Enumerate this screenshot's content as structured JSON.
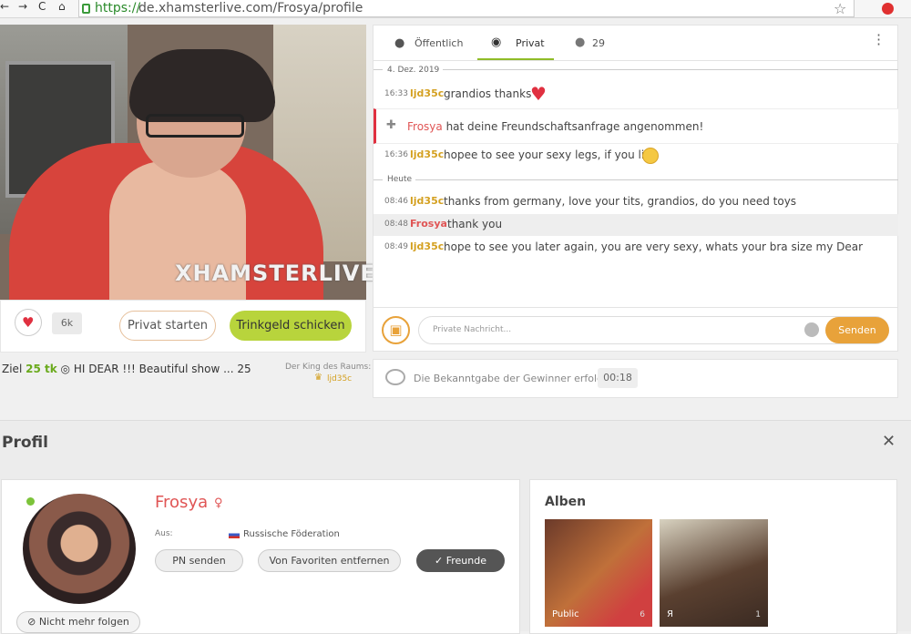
{
  "browser": {
    "back": "←",
    "forward": "→",
    "reload": "C",
    "home": "⌂",
    "url_scheme": "https://",
    "url_rest": "de.xhamsterlive.com/Frosya/profile",
    "star": "☆"
  },
  "video": {
    "watermark": "XHAMSTERLIVE"
  },
  "actions": {
    "likes": "6k",
    "private_label": "Privat starten",
    "tip_label": "Trinkgeld schicken"
  },
  "goal": {
    "prefix": "Ziel",
    "amount": "25 tk",
    "text": "HI DEAR !!! Beautiful show ... 25",
    "king_label": "Der King des Raums:",
    "king_name": "ljd35c"
  },
  "chat": {
    "tabs": [
      {
        "label": "Öffentlich",
        "icon": "speech-bubble-icon"
      },
      {
        "label": "Privat",
        "icon": "chat-bubbles-icon"
      },
      {
        "label": "29",
        "icon": "user-icon"
      }
    ],
    "date1": "4. Dez. 2019",
    "date2": "Heute",
    "messages": [
      {
        "time": "16:33",
        "user": "ljd35c",
        "text": "grandios thanks"
      },
      {
        "time": "16:36",
        "user": "ljd35c",
        "text": "hopee to see your sexy legs, if you like"
      },
      {
        "time": "08:46",
        "user": "ljd35c",
        "text": "thanks from germany, love your tits, grandios, do you need toys"
      },
      {
        "time": "08:48",
        "user": "Frosya",
        "text": "thank you"
      },
      {
        "time": "08:49",
        "user": "ljd35c",
        "text": "hope to see you later again, you are very sexy, whats your bra size my Dear"
      }
    ],
    "notification_user": "Frosya",
    "notification_text": "hat deine Freundschaftsanfrage angenommen!",
    "input_placeholder": "Private Nachricht...",
    "send_label": "Senden"
  },
  "announcement": {
    "text": "Die Bekanntgabe der Gewinner erfolgt in",
    "timer": "00:18"
  },
  "profile": {
    "section_title": "Profil",
    "name": "Frosya",
    "gender_symbol": "♀",
    "from_label": "Aus:",
    "country": "Russische Föderation",
    "btn_pn": "PN senden",
    "btn_fav": "Von Favoriten entfernen",
    "btn_friends": "✓ Freunde",
    "btn_unfollow": "Nicht mehr folgen"
  },
  "albums": {
    "title": "Alben",
    "items": [
      {
        "label": "Public",
        "count": "6"
      },
      {
        "label": "Я",
        "count": "1"
      }
    ]
  },
  "colors": {
    "accent_green": "#b8d43c",
    "accent_orange": "#e8a23a",
    "name_red": "#e05555",
    "user_gold": "#d4a020"
  }
}
